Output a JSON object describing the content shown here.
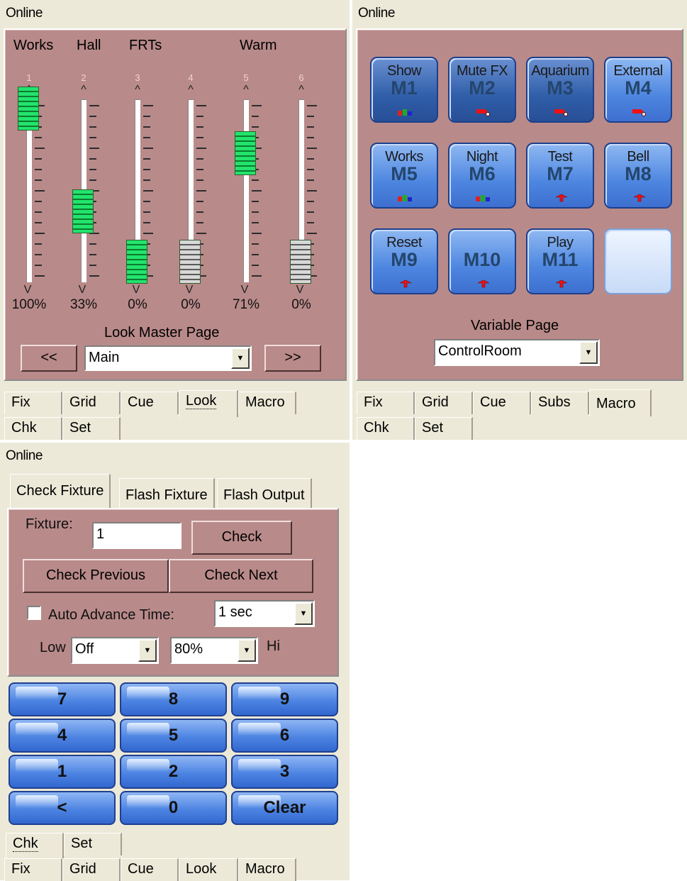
{
  "panel_look": {
    "status": "Online",
    "group_labels": [
      "Works",
      "Hall",
      "FRTs",
      "Warm"
    ],
    "faders": [
      {
        "num": "1",
        "level": "100%",
        "value": 1.0,
        "color": "green"
      },
      {
        "num": "2",
        "level": "33%",
        "value": 0.33,
        "color": "green"
      },
      {
        "num": "3",
        "level": "0%",
        "value": 0.0,
        "color": "green"
      },
      {
        "num": "4",
        "level": "0%",
        "value": 0.0,
        "color": "gray"
      },
      {
        "num": "5",
        "level": "71%",
        "value": 0.71,
        "color": "green"
      },
      {
        "num": "6",
        "level": "0%",
        "value": 0.0,
        "color": "gray"
      }
    ],
    "arrow_up": "^",
    "arrow_down": "V",
    "page_title": "Look Master Page",
    "prev_label": "<<",
    "next_label": ">>",
    "page_select": "Main",
    "tabs_row1": [
      "Fix",
      "Grid",
      "Cue",
      "Look",
      "Macro"
    ],
    "tabs_row2": [
      "Chk",
      "Set"
    ],
    "active_tab": "Look"
  },
  "panel_macro": {
    "status": "Online",
    "macros": [
      {
        "name": "Show",
        "num": "M1",
        "icon": "rgb-bars-icon",
        "style": "dark"
      },
      {
        "name": "Mute FX",
        "num": "M2",
        "icon": "red-cog-icon",
        "style": "dark"
      },
      {
        "name": "Aquarium",
        "num": "M3",
        "icon": "red-cog-icon",
        "style": "dark"
      },
      {
        "name": "External",
        "num": "M4",
        "icon": "red-cog-icon",
        "style": "light"
      },
      {
        "name": "Works",
        "num": "M5",
        "icon": "rgb-bars-icon",
        "style": "light"
      },
      {
        "name": "Night",
        "num": "M6",
        "icon": "rgb-bars-icon",
        "style": "light"
      },
      {
        "name": "Test",
        "num": "M7",
        "icon": "red-arrow-icon",
        "style": "light"
      },
      {
        "name": "Bell",
        "num": "M8",
        "icon": "red-arrow-icon",
        "style": "light"
      },
      {
        "name": "Reset",
        "num": "M9",
        "icon": "red-arrow-icon",
        "style": "light"
      },
      {
        "name": "",
        "num": "M10",
        "icon": "red-arrow-icon",
        "style": "light"
      },
      {
        "name": "Play",
        "num": "M11",
        "icon": "red-arrow-icon",
        "style": "light"
      },
      {
        "name": "",
        "num": "",
        "icon": "",
        "style": "empty"
      }
    ],
    "page_title": "Variable Page",
    "page_select": "ControlRoom",
    "tabs_row1": [
      "Fix",
      "Grid",
      "Cue",
      "Subs",
      "Macro"
    ],
    "tabs_row2": [
      "Chk",
      "Set"
    ],
    "active_tab": "Macro"
  },
  "panel_check": {
    "status": "Online",
    "subtabs": [
      "Check Fixture",
      "Flash Fixture",
      "Flash Output"
    ],
    "active_subtab": "Check Fixture",
    "fixture_label": "Fixture:",
    "fixture_value": "1",
    "check_label": "Check",
    "check_prev_label": "Check Previous",
    "check_next_label": "Check Next",
    "auto_advance_label": "Auto Advance Time:",
    "auto_advance_checked": false,
    "auto_advance_value": "1 sec",
    "low_label": "Low",
    "low_value": "Off",
    "hi_value": "80%",
    "hi_label": "Hi",
    "keypad": [
      "7",
      "8",
      "9",
      "4",
      "5",
      "6",
      "1",
      "2",
      "3",
      "<",
      "0",
      "Clear"
    ],
    "tabs_row1": [
      "Chk",
      "Set"
    ],
    "tabs_row2": [
      "Fix",
      "Grid",
      "Cue",
      "Look",
      "Macro"
    ],
    "active_tab": "Chk"
  }
}
